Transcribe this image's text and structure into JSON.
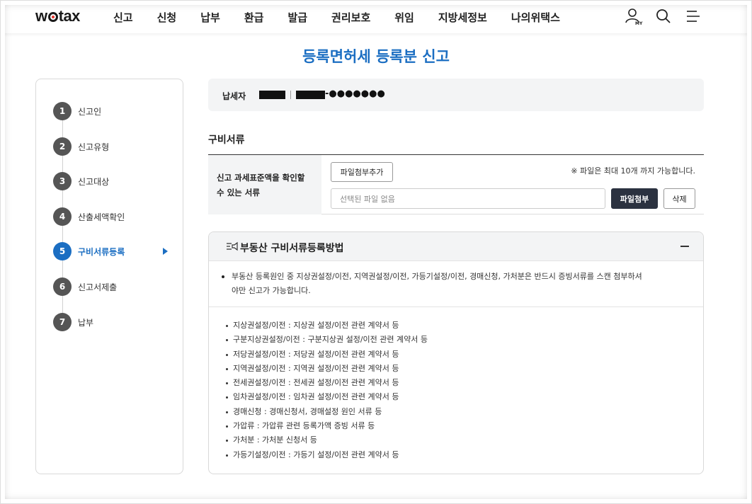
{
  "header": {
    "logo": "wetax",
    "nav": [
      "신고",
      "신청",
      "납부",
      "환급",
      "발급",
      "권리보호",
      "위임",
      "지방세정보",
      "나의위택스"
    ],
    "icons": [
      "my-page-icon",
      "search-icon",
      "menu-icon"
    ],
    "my_label": "MY"
  },
  "page": {
    "title": "등록면허세 등록분 신고"
  },
  "steps": [
    {
      "num": "1",
      "label": "신고인"
    },
    {
      "num": "2",
      "label": "신고유형"
    },
    {
      "num": "3",
      "label": "신고대상"
    },
    {
      "num": "4",
      "label": "산출세액확인"
    },
    {
      "num": "5",
      "label": "구비서류등록",
      "active": true
    },
    {
      "num": "6",
      "label": "신고서제출"
    },
    {
      "num": "7",
      "label": "납부"
    }
  ],
  "taxpayer": {
    "label": "납세자",
    "masked_suffix": "-●●●●●●●"
  },
  "docs": {
    "section_title": "구비서류",
    "row_header": "신고 과세표준액을 확인할 수 있는 서류",
    "add_button": "파일첨부추가",
    "note": "※ 파일은 최대 10개 까지 가능합니다.",
    "file_placeholder": "선택된 파일 없음",
    "attach_button": "파일첨부",
    "delete_button": "삭제"
  },
  "guide": {
    "title": "부동산 구비서류등록방법",
    "intro": "부동산 등록원인 중 지상권설정/이전, 지역권설정/이전, 가등기설정/이전, 경매신청, 가처분은 반드시 증빙서류를 스캔 첨부하셔야만 신고가 가능합니다.",
    "items": [
      "지상권설정/이전 : 지상권 설정/이전 관련 계약서 등",
      "구분지상권설정/이전 : 구분지상권 설정/이전 관련 계약서 등",
      "저당권설정/이전 : 저당권 설정/이전 관련 계약서 등",
      "지역권설정/이전 : 지역권 설정/이전 관련 계약서 등",
      "전세권설정/이전 : 전세권 설정/이전 관련 계약서 등",
      "임차권설정/이전 : 임차권 설정/이전 관련 계약서 등",
      "경매신청 : 경매신청서, 경매설정 원인 서류 등",
      "가압류 : 가압류 관련 등록가액 증빙 서류 등",
      "가처분 : 가처분 신청서 등",
      "가등기설정/이전 : 가등기 설정/이전 관련 계약서 등"
    ]
  },
  "colors": {
    "accent": "#1b6ec2",
    "dark_button": "#2b3240",
    "panel_bg": "#f3f4f5"
  }
}
